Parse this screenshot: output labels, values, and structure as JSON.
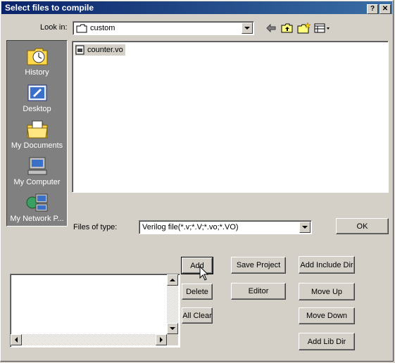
{
  "window": {
    "title": "Select files to compile",
    "help_glyph": "?",
    "close_glyph": "✕"
  },
  "look_in": {
    "label": "Look in:",
    "value": "custom"
  },
  "toolbar": {
    "icons": [
      "back-arrow-icon",
      "up-folder-icon",
      "new-folder-icon",
      "view-menu-icon"
    ]
  },
  "places": [
    {
      "label": "History",
      "icon": "history-icon"
    },
    {
      "label": "Desktop",
      "icon": "desktop-icon"
    },
    {
      "label": "My Documents",
      "icon": "my-documents-icon"
    },
    {
      "label": "My Computer",
      "icon": "my-computer-icon"
    },
    {
      "label": "My Network P...",
      "icon": "network-places-icon"
    }
  ],
  "files": [
    {
      "name": "counter.vo",
      "icon": "file-icon"
    }
  ],
  "file_type": {
    "label": "Files of type:",
    "value": "Verilog file(*.v;*.V;*.vo;*.VO)"
  },
  "buttons": {
    "ok": "OK",
    "add": "Add",
    "delete": "Delete",
    "all_clear": "All Clear",
    "save_project": "Save Project",
    "editor": "Editor",
    "add_include_dir": "Add Include Dir",
    "move_up": "Move Up",
    "move_down": "Move Down",
    "add_lib_dir": "Add Lib Dir"
  },
  "colors": {
    "title_start": "#0a246a",
    "title_end": "#3a6ea5",
    "face": "#d4d0c8",
    "places_bg": "#808080"
  }
}
